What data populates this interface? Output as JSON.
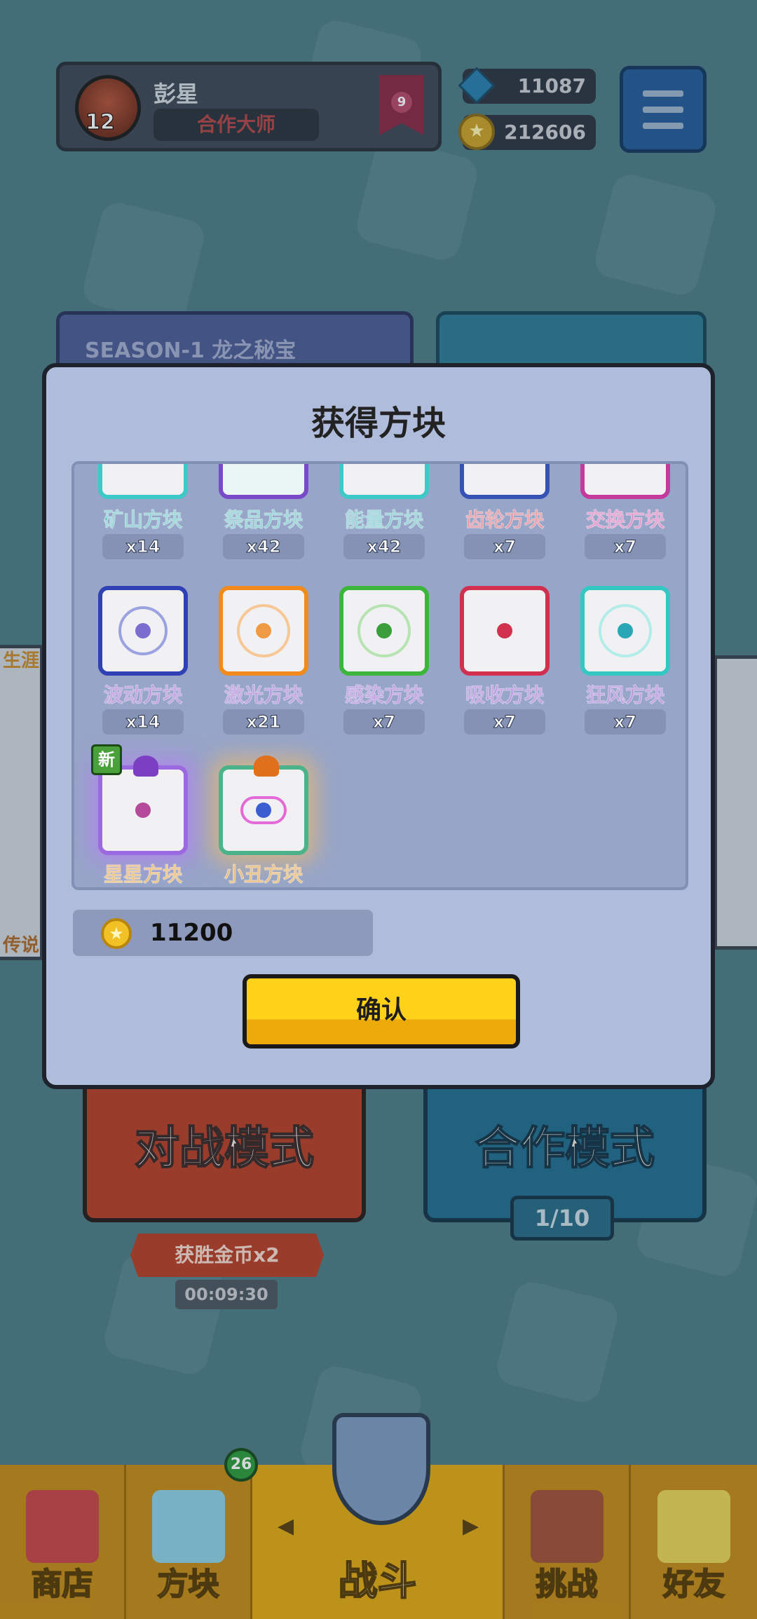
{
  "profile": {
    "name": "彭星",
    "title": "合作大师",
    "level": "12",
    "rank": "9"
  },
  "currency": {
    "gems": "11087",
    "coins": "212606"
  },
  "season_card": {
    "label": "SEASON-1 龙之秘宝"
  },
  "side": {
    "left_top_label": "生涯",
    "left_bottom_label": "传说"
  },
  "modes": {
    "battle": {
      "label": "对战模式",
      "bonus": "获胜金币x2",
      "timer": "00:09:30"
    },
    "coop": {
      "label": "合作模式",
      "count": "1/10"
    }
  },
  "modal": {
    "title": "获得方块",
    "blocks": [
      {
        "name": "矿山方块",
        "count": "x14",
        "color": "#3ec9c9",
        "name_color": "#2aa6b0"
      },
      {
        "name": "祭品方块",
        "count": "x42",
        "color": "#7a49c9",
        "name_color": "#2aa6b0"
      },
      {
        "name": "能量方块",
        "count": "x42",
        "color": "#3ec9c9",
        "name_color": "#2aa6b0"
      },
      {
        "name": "齿轮方块",
        "count": "x7",
        "color": "#3553b5",
        "name_color": "#c63a52"
      },
      {
        "name": "交换方块",
        "count": "x7",
        "color": "#c6399c",
        "name_color": "#c6399c"
      },
      {
        "name": "波动方块",
        "count": "x14",
        "color": "#3042b3",
        "name_color": "#7a3fc0"
      },
      {
        "name": "激光方块",
        "count": "x21",
        "color": "#f08a1c",
        "name_color": "#7a3fc0"
      },
      {
        "name": "感染方块",
        "count": "x7",
        "color": "#3bb53a",
        "name_color": "#7a3fc0"
      },
      {
        "name": "吸收方块",
        "count": "x7",
        "color": "#d1304f",
        "name_color": "#7a3fc0"
      },
      {
        "name": "狂风方块",
        "count": "x7",
        "color": "#35c7c2",
        "name_color": "#7a3fc0"
      },
      {
        "name": "星星方块",
        "count": "",
        "color": "#9b6ae0",
        "name_color": "#d4860e"
      },
      {
        "name": "小丑方块",
        "count": "",
        "color": "#4cb28a",
        "name_color": "#d4860e"
      }
    ],
    "new_tag": "新",
    "coins_earned": "11200",
    "confirm_label": "确认"
  },
  "nav": {
    "tabs": [
      {
        "label": "商店"
      },
      {
        "label": "方块"
      },
      {
        "label": "战斗"
      },
      {
        "label": "挑战"
      },
      {
        "label": "好友"
      }
    ],
    "blocks_badge": "26"
  }
}
